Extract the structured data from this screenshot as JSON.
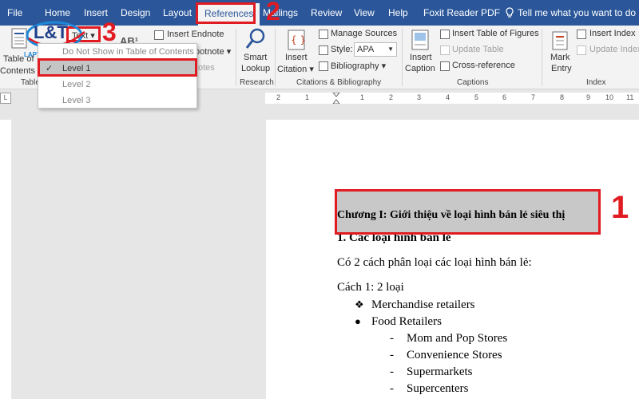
{
  "tabs": [
    "File",
    "Home",
    "Insert",
    "Design",
    "Layout",
    "References",
    "Mailings",
    "Review",
    "View",
    "Help",
    "Foxit Reader PDF"
  ],
  "tell_me": "Tell me what you want to do",
  "ribbon": {
    "toc": {
      "line1": "Table of",
      "line2": "Contents ▾",
      "group": "Table of"
    },
    "add_text": "Text ▾",
    "insert_endnote": "Insert Endnote",
    "next_footnote_partial": "ootnote ▾",
    "show_notes_partial": "otes",
    "footnote_ab": "AB¹",
    "smart_lookup": {
      "line1": "Smart",
      "line2": "Lookup",
      "group": "Research"
    },
    "insert_citation": {
      "line1": "Insert",
      "line2": "Citation ▾"
    },
    "manage_sources": "Manage Sources",
    "style_label": "Style:",
    "style_value": "APA",
    "bibliography": "Bibliography ▾",
    "citations_group": "Citations & Bibliography",
    "insert_caption": {
      "line1": "Insert",
      "line2": "Caption"
    },
    "insert_table_of_figures": "Insert Table of Figures",
    "update_table": "Update Table",
    "cross_reference": "Cross-reference",
    "captions_group": "Captions",
    "mark_entry": {
      "line1": "Mark",
      "line2": "Entry"
    },
    "insert_index": "Insert Index",
    "update_index": "Update Index",
    "index_group": "Index"
  },
  "dropdown": {
    "items": [
      {
        "label": "Do Not Show in Table of Contents"
      },
      {
        "label": "Level 1",
        "check": "✓"
      },
      {
        "label": "Level 2"
      },
      {
        "label": "Level 3"
      }
    ]
  },
  "logo": {
    "text": "L&T",
    "subtext": "LAPTOP TAI THINH"
  },
  "ruler": {
    "corner": "L",
    "marks": [
      "2",
      "1",
      "1",
      "2",
      "3",
      "4",
      "5",
      "6",
      "7",
      "8",
      "9",
      "10",
      "11"
    ]
  },
  "document": {
    "heading": "Chương I: Giới thiệu về loại hình bán lẻ siêu thị",
    "subheading": "1. Các loại hình bán lẻ",
    "para1": "Có 2 cách phân loại các loại hình bán lẻ:",
    "para2": "Cách 1: 2 loại",
    "bullets": [
      {
        "marker": "❖",
        "text": "Merchandise retailers"
      },
      {
        "marker": "●",
        "text": "Food Retailers"
      }
    ],
    "sub_bullets": [
      {
        "marker": "-",
        "text": "Mom and Pop Stores"
      },
      {
        "marker": "-",
        "text": "Convenience Stores"
      },
      {
        "marker": "-",
        "text": "Supermarkets"
      },
      {
        "marker": "-",
        "text": "Supercenters"
      }
    ]
  },
  "annotations": {
    "one": "1",
    "two": "2",
    "three": "3",
    "color": "#e11b22"
  },
  "colors": {
    "ribbon_blue": "#2b579a",
    "highlight_gray": "#c8c8c8"
  }
}
